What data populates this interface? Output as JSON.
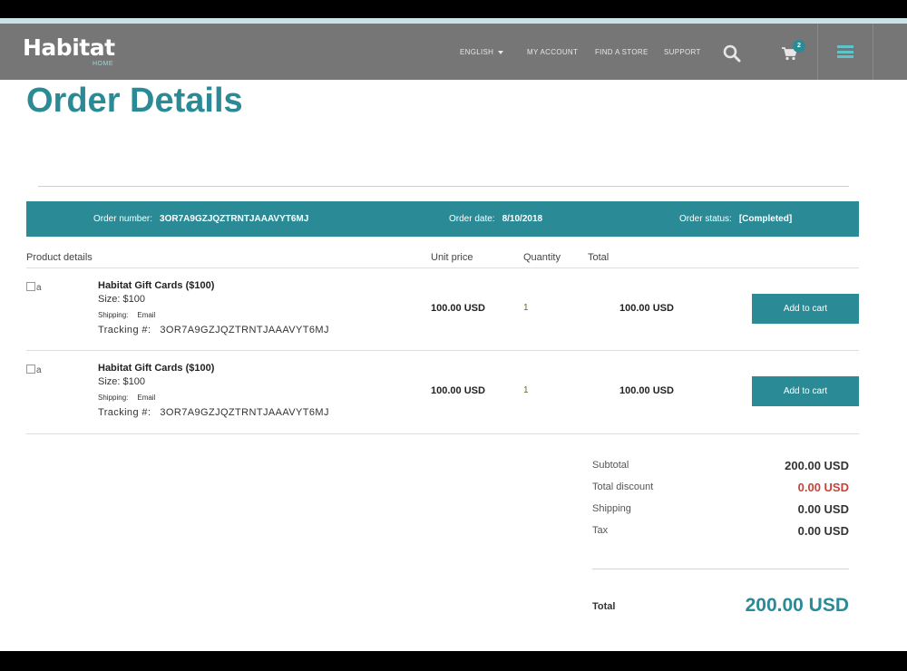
{
  "header": {
    "logo": "Habitat",
    "logo_sub": "HOME",
    "language": "ENGLISH",
    "my_account": "MY ACCOUNT",
    "find_store": "FIND A STORE",
    "support": "SUPPORT",
    "cart_count": "2",
    "icons": [
      "search-icon",
      "cart-icon",
      "menu-icon"
    ]
  },
  "page": {
    "title": "Order Details"
  },
  "order": {
    "number_label": "Order number:",
    "number": "3OR7A9GZJQZTRNTJAAAVYT6MJ",
    "date_label": "Order date:",
    "date": "8/10/2018",
    "status_label": "Order status:",
    "status": "[Completed]"
  },
  "table": {
    "headers": {
      "product": "Product details",
      "unit": "Unit price",
      "qty": "Quantity",
      "total": "Total"
    },
    "rows": [
      {
        "img_alt": "a",
        "name": "Habitat Gift Cards ($100)",
        "size": "Size: $100",
        "shipping_label": "Shipping:",
        "shipping": "Email",
        "tracking_label": "Tracking #:",
        "tracking": "3OR7A9GZJQZTRNTJAAAVYT6MJ",
        "unit_price": "100.00 USD",
        "qty": "1",
        "total": "100.00 USD",
        "button": "Add to cart"
      },
      {
        "img_alt": "a",
        "name": "Habitat Gift Cards ($100)",
        "size": "Size: $100",
        "shipping_label": "Shipping:",
        "shipping": "Email",
        "tracking_label": "Tracking #:",
        "tracking": "3OR7A9GZJQZTRNTJAAAVYT6MJ",
        "unit_price": "100.00 USD",
        "qty": "1",
        "total": "100.00 USD",
        "button": "Add to cart"
      }
    ]
  },
  "summary": {
    "subtotal_label": "Subtotal",
    "subtotal": "200.00 USD",
    "discount_label": "Total discount",
    "discount": "0.00 USD",
    "shipping_label": "Shipping",
    "shipping": "0.00 USD",
    "tax_label": "Tax",
    "tax": "0.00 USD",
    "total_label": "Total",
    "total": "200.00 USD"
  },
  "colors": {
    "brand": "#2a8b96",
    "header_bg": "#767676",
    "discount": "#c8423a"
  }
}
